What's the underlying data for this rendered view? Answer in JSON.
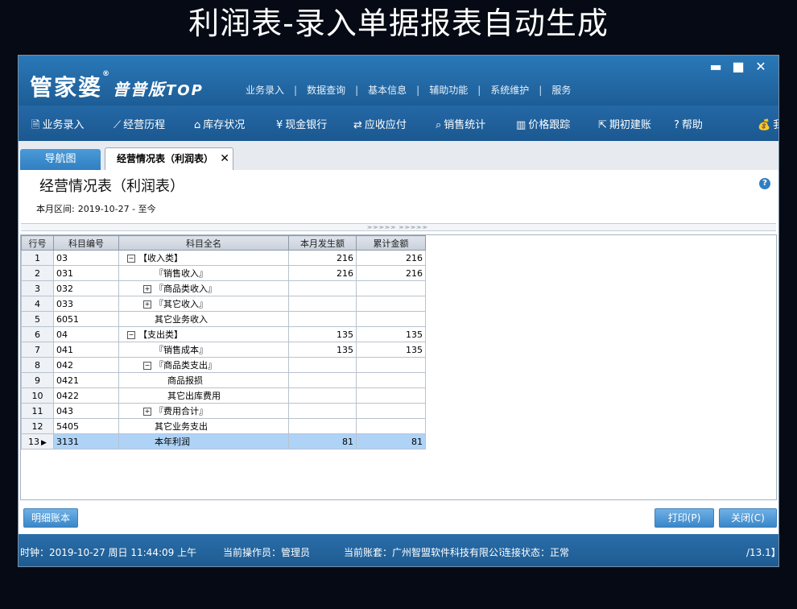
{
  "banner": {
    "title": "利润表-录入单据报表自动生成"
  },
  "app": {
    "logo_main": "管家婆",
    "logo_reg": "®",
    "logo_sub": "普普版",
    "logo_top": "TOP"
  },
  "top_menu": [
    "业务录入",
    "数据查询",
    "基本信息",
    "辅助功能",
    "系统维护",
    "服务"
  ],
  "top_menu_sep": "|",
  "window_controls": {
    "minimize": "▬",
    "maximize": "■",
    "close": "✕"
  },
  "toolbar": [
    {
      "icon": "document-icon",
      "glyph": "🗎",
      "label": "业务录入"
    },
    {
      "icon": "chart-icon",
      "glyph": "⟋",
      "label": "经营历程"
    },
    {
      "icon": "home-icon",
      "glyph": "⌂",
      "label": "库存状况"
    },
    {
      "icon": "yen-icon",
      "glyph": "¥",
      "label": "现金银行"
    },
    {
      "icon": "exchange-icon",
      "glyph": "⇄",
      "label": "应收应付"
    },
    {
      "icon": "search-icon",
      "glyph": "⌕",
      "label": "销售统计"
    },
    {
      "icon": "bar-chart-icon",
      "glyph": "▥",
      "label": "价格跟踪"
    },
    {
      "icon": "external-link-icon",
      "glyph": "⇱",
      "label": "期初建账"
    },
    {
      "icon": "help-icon",
      "glyph": "?",
      "label": "帮助"
    },
    {
      "icon": "money-bag-icon",
      "glyph": "💰",
      "label": "我"
    }
  ],
  "tabs": {
    "nav_label": "导航图",
    "active_label": "经营情况表（利润表）",
    "close_glyph": "✕"
  },
  "report": {
    "title": "经营情况表（利润表）",
    "help_glyph": "?",
    "range_label": "本月区间:",
    "range_value": "2019-10-27 - 至今",
    "grip": "≫≫≫≫≫ ≫≫≫≫≫"
  },
  "table": {
    "columns": [
      "行号",
      "科目编号",
      "科目全名",
      "本月发生额",
      "累计金额"
    ],
    "rows": [
      {
        "row": "1",
        "code": "03",
        "name": "【收入类】",
        "indent": 0,
        "exp": "⊟",
        "month": "216",
        "total": "216"
      },
      {
        "row": "2",
        "code": "031",
        "name": "『销售收入』",
        "indent": 1,
        "exp": "",
        "month": "216",
        "total": "216"
      },
      {
        "row": "3",
        "code": "032",
        "name": "『商品类收入』",
        "indent": 1,
        "exp": "⊞",
        "month": "",
        "total": ""
      },
      {
        "row": "4",
        "code": "033",
        "name": "『其它收入』",
        "indent": 1,
        "exp": "⊞",
        "month": "",
        "total": ""
      },
      {
        "row": "5",
        "code": "6051",
        "name": "其它业务收入",
        "indent": 1,
        "exp": "",
        "month": "",
        "total": ""
      },
      {
        "row": "6",
        "code": "04",
        "name": "【支出类】",
        "indent": 0,
        "exp": "⊟",
        "month": "135",
        "total": "135"
      },
      {
        "row": "7",
        "code": "041",
        "name": "『销售成本』",
        "indent": 1,
        "exp": "",
        "month": "135",
        "total": "135"
      },
      {
        "row": "8",
        "code": "042",
        "name": "『商品类支出』",
        "indent": 1,
        "exp": "⊟",
        "month": "",
        "total": ""
      },
      {
        "row": "9",
        "code": "0421",
        "name": "商品报损",
        "indent": 2,
        "exp": "",
        "month": "",
        "total": ""
      },
      {
        "row": "10",
        "code": "0422",
        "name": "其它出库费用",
        "indent": 2,
        "exp": "",
        "month": "",
        "total": ""
      },
      {
        "row": "11",
        "code": "043",
        "name": "『费用合计』",
        "indent": 1,
        "exp": "⊞",
        "month": "",
        "total": ""
      },
      {
        "row": "12",
        "code": "5405",
        "name": "其它业务支出",
        "indent": 1,
        "exp": "",
        "month": "",
        "total": ""
      },
      {
        "row": "13",
        "code": "3131",
        "name": "本年利润",
        "indent": 1,
        "exp": "",
        "month": "81",
        "total": "81",
        "selected": true,
        "pointer": "▶"
      }
    ]
  },
  "buttons": {
    "detail": "明细账本",
    "print": "打印(P)",
    "close": "关闭(C)"
  },
  "status": {
    "clock": "时钟：2019-10-27 周日 11:44:09 上午",
    "operator": "当前操作员：管理员",
    "account": "当前账套：广州智盟软件科技有限公司",
    "connection": "连接状态：正常",
    "version": "/13.1】"
  }
}
